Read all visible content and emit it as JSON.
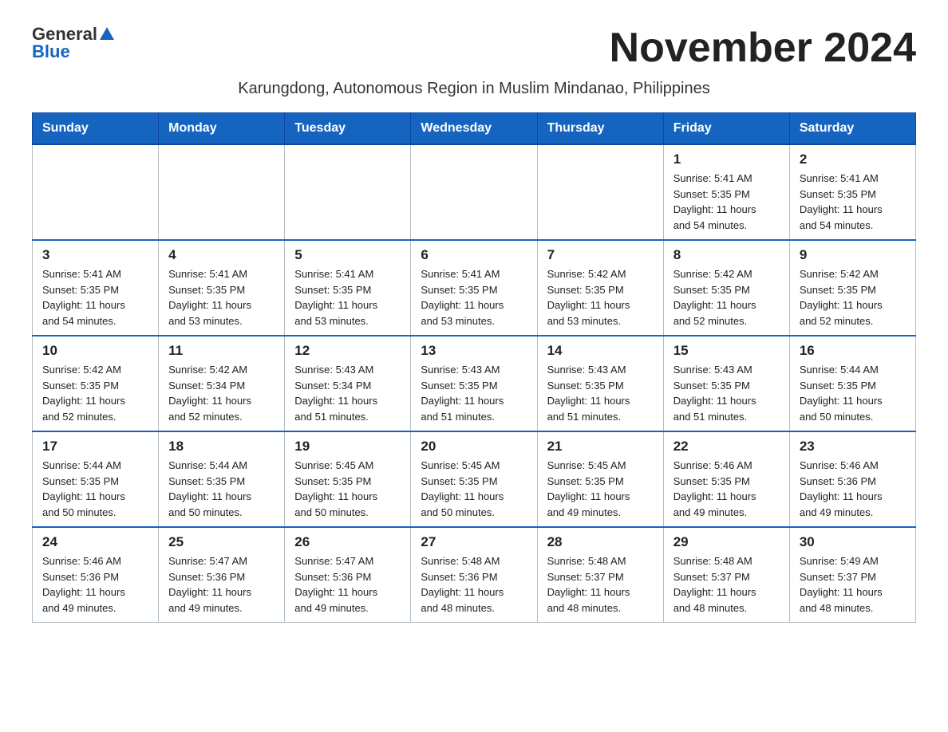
{
  "logo": {
    "general": "General",
    "blue": "Blue",
    "triangle": "▲"
  },
  "title": "November 2024",
  "subtitle": "Karungdong, Autonomous Region in Muslim Mindanao, Philippines",
  "headers": [
    "Sunday",
    "Monday",
    "Tuesday",
    "Wednesday",
    "Thursday",
    "Friday",
    "Saturday"
  ],
  "weeks": [
    [
      {
        "day": "",
        "info": ""
      },
      {
        "day": "",
        "info": ""
      },
      {
        "day": "",
        "info": ""
      },
      {
        "day": "",
        "info": ""
      },
      {
        "day": "",
        "info": ""
      },
      {
        "day": "1",
        "info": "Sunrise: 5:41 AM\nSunset: 5:35 PM\nDaylight: 11 hours\nand 54 minutes."
      },
      {
        "day": "2",
        "info": "Sunrise: 5:41 AM\nSunset: 5:35 PM\nDaylight: 11 hours\nand 54 minutes."
      }
    ],
    [
      {
        "day": "3",
        "info": "Sunrise: 5:41 AM\nSunset: 5:35 PM\nDaylight: 11 hours\nand 54 minutes."
      },
      {
        "day": "4",
        "info": "Sunrise: 5:41 AM\nSunset: 5:35 PM\nDaylight: 11 hours\nand 53 minutes."
      },
      {
        "day": "5",
        "info": "Sunrise: 5:41 AM\nSunset: 5:35 PM\nDaylight: 11 hours\nand 53 minutes."
      },
      {
        "day": "6",
        "info": "Sunrise: 5:41 AM\nSunset: 5:35 PM\nDaylight: 11 hours\nand 53 minutes."
      },
      {
        "day": "7",
        "info": "Sunrise: 5:42 AM\nSunset: 5:35 PM\nDaylight: 11 hours\nand 53 minutes."
      },
      {
        "day": "8",
        "info": "Sunrise: 5:42 AM\nSunset: 5:35 PM\nDaylight: 11 hours\nand 52 minutes."
      },
      {
        "day": "9",
        "info": "Sunrise: 5:42 AM\nSunset: 5:35 PM\nDaylight: 11 hours\nand 52 minutes."
      }
    ],
    [
      {
        "day": "10",
        "info": "Sunrise: 5:42 AM\nSunset: 5:35 PM\nDaylight: 11 hours\nand 52 minutes."
      },
      {
        "day": "11",
        "info": "Sunrise: 5:42 AM\nSunset: 5:34 PM\nDaylight: 11 hours\nand 52 minutes."
      },
      {
        "day": "12",
        "info": "Sunrise: 5:43 AM\nSunset: 5:34 PM\nDaylight: 11 hours\nand 51 minutes."
      },
      {
        "day": "13",
        "info": "Sunrise: 5:43 AM\nSunset: 5:35 PM\nDaylight: 11 hours\nand 51 minutes."
      },
      {
        "day": "14",
        "info": "Sunrise: 5:43 AM\nSunset: 5:35 PM\nDaylight: 11 hours\nand 51 minutes."
      },
      {
        "day": "15",
        "info": "Sunrise: 5:43 AM\nSunset: 5:35 PM\nDaylight: 11 hours\nand 51 minutes."
      },
      {
        "day": "16",
        "info": "Sunrise: 5:44 AM\nSunset: 5:35 PM\nDaylight: 11 hours\nand 50 minutes."
      }
    ],
    [
      {
        "day": "17",
        "info": "Sunrise: 5:44 AM\nSunset: 5:35 PM\nDaylight: 11 hours\nand 50 minutes."
      },
      {
        "day": "18",
        "info": "Sunrise: 5:44 AM\nSunset: 5:35 PM\nDaylight: 11 hours\nand 50 minutes."
      },
      {
        "day": "19",
        "info": "Sunrise: 5:45 AM\nSunset: 5:35 PM\nDaylight: 11 hours\nand 50 minutes."
      },
      {
        "day": "20",
        "info": "Sunrise: 5:45 AM\nSunset: 5:35 PM\nDaylight: 11 hours\nand 50 minutes."
      },
      {
        "day": "21",
        "info": "Sunrise: 5:45 AM\nSunset: 5:35 PM\nDaylight: 11 hours\nand 49 minutes."
      },
      {
        "day": "22",
        "info": "Sunrise: 5:46 AM\nSunset: 5:35 PM\nDaylight: 11 hours\nand 49 minutes."
      },
      {
        "day": "23",
        "info": "Sunrise: 5:46 AM\nSunset: 5:36 PM\nDaylight: 11 hours\nand 49 minutes."
      }
    ],
    [
      {
        "day": "24",
        "info": "Sunrise: 5:46 AM\nSunset: 5:36 PM\nDaylight: 11 hours\nand 49 minutes."
      },
      {
        "day": "25",
        "info": "Sunrise: 5:47 AM\nSunset: 5:36 PM\nDaylight: 11 hours\nand 49 minutes."
      },
      {
        "day": "26",
        "info": "Sunrise: 5:47 AM\nSunset: 5:36 PM\nDaylight: 11 hours\nand 49 minutes."
      },
      {
        "day": "27",
        "info": "Sunrise: 5:48 AM\nSunset: 5:36 PM\nDaylight: 11 hours\nand 48 minutes."
      },
      {
        "day": "28",
        "info": "Sunrise: 5:48 AM\nSunset: 5:37 PM\nDaylight: 11 hours\nand 48 minutes."
      },
      {
        "day": "29",
        "info": "Sunrise: 5:48 AM\nSunset: 5:37 PM\nDaylight: 11 hours\nand 48 minutes."
      },
      {
        "day": "30",
        "info": "Sunrise: 5:49 AM\nSunset: 5:37 PM\nDaylight: 11 hours\nand 48 minutes."
      }
    ]
  ]
}
